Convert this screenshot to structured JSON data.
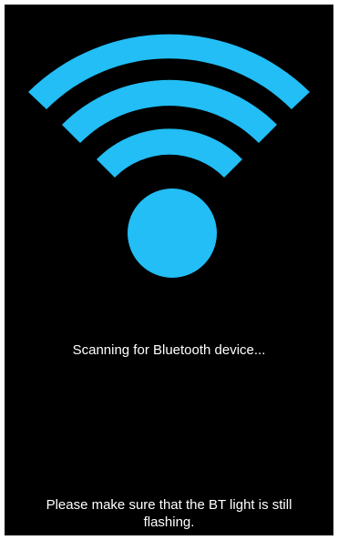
{
  "colors": {
    "background": "#000000",
    "accent": "#22BEF5",
    "text": "#FFFFFF"
  },
  "graphic": {
    "icon": "wifi-signal-icon"
  },
  "status": {
    "message": "Scanning for Bluetooth device..."
  },
  "hint": {
    "message": "Please make sure that the BT light is still flashing."
  }
}
